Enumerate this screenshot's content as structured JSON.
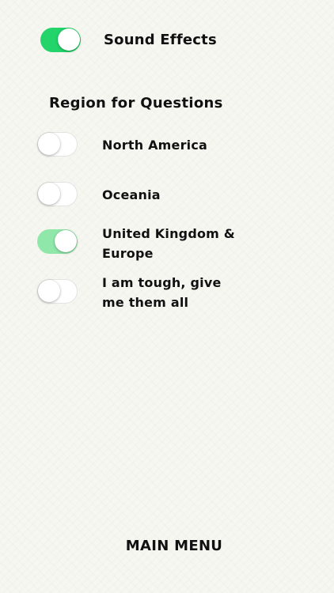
{
  "sound_effects": {
    "label": "Sound Effects",
    "enabled": true
  },
  "region_heading": "Region for Questions",
  "regions": [
    {
      "label": "North America",
      "enabled": false
    },
    {
      "label": "Oceania",
      "enabled": false
    },
    {
      "label": "United Kingdom & Europe",
      "line1": "United Kingdom &",
      "line2": "Europe",
      "enabled": true
    },
    {
      "label": "I am tough, give me them all",
      "line1": "I am tough, give",
      "line2": "me them all",
      "enabled": false
    }
  ],
  "main_menu_label": "MAIN MENU",
  "colors": {
    "toggle_on": "#22d46a",
    "toggle_on_faded": "#8fe8a9",
    "background": "#f7f7f2"
  }
}
